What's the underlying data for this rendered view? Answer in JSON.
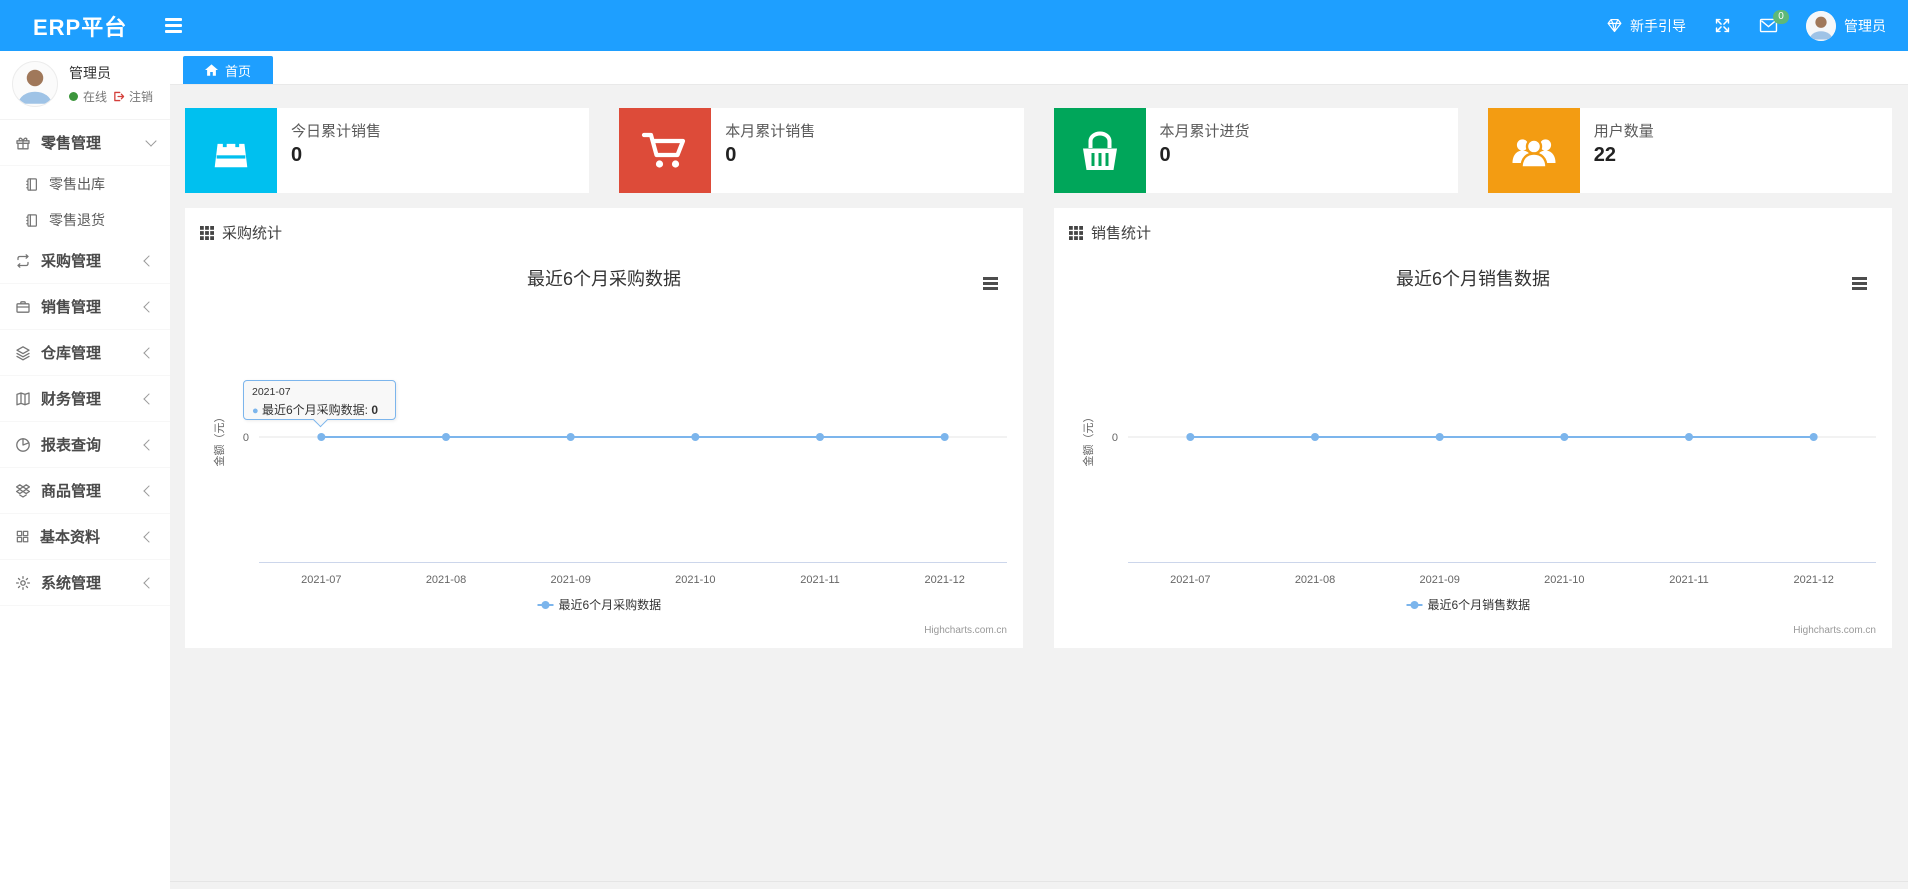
{
  "navbar": {
    "brand": "ERP平台",
    "guide_label": "新手引导",
    "mail_badge": "0",
    "user_name": "管理员",
    "badge_color": "#5FB878",
    "bar_color": "#1E9FFF"
  },
  "sidebar": {
    "user": {
      "name": "管理员",
      "status_label": "在线",
      "logout_label": "注销"
    },
    "items": [
      {
        "id": "retail",
        "label": "零售管理",
        "icon": "gift-icon",
        "expanded": true,
        "children": [
          {
            "id": "retail-outbound",
            "label": "零售出库",
            "icon": "journal-icon"
          },
          {
            "id": "retail-return",
            "label": "零售退货",
            "icon": "journal-icon"
          }
        ]
      },
      {
        "id": "purchase",
        "label": "采购管理",
        "icon": "loop-icon"
      },
      {
        "id": "sales",
        "label": "销售管理",
        "icon": "briefcase-icon"
      },
      {
        "id": "warehouse",
        "label": "仓库管理",
        "icon": "layers-icon"
      },
      {
        "id": "finance",
        "label": "财务管理",
        "icon": "book-icon"
      },
      {
        "id": "reports",
        "label": "报表查询",
        "icon": "pie-chart-icon"
      },
      {
        "id": "goods",
        "label": "商品管理",
        "icon": "box-icon"
      },
      {
        "id": "basic-data",
        "label": "基本资料",
        "icon": "grid-icon"
      },
      {
        "id": "system",
        "label": "系统管理",
        "icon": "gear-icon"
      }
    ]
  },
  "tabs": [
    {
      "id": "home",
      "label": "首页",
      "icon": "home-icon",
      "active": true
    }
  ],
  "stat_cards": [
    {
      "id": "today-sales",
      "label": "今日累计销售",
      "value": "0",
      "icon": "shopping-bag-icon",
      "color": "#00c0ef"
    },
    {
      "id": "month-sales",
      "label": "本月累计销售",
      "value": "0",
      "icon": "cart-icon",
      "color": "#dd4b39"
    },
    {
      "id": "month-purchase",
      "label": "本月累计进货",
      "value": "0",
      "icon": "basket-icon",
      "color": "#00a65a"
    },
    {
      "id": "user-count",
      "label": "用户数量",
      "value": "22",
      "icon": "users-icon",
      "color": "#f39c12"
    }
  ],
  "panels": [
    {
      "id": "purchase-stats",
      "title": "采购统计"
    },
    {
      "id": "sales-stats",
      "title": "销售统计"
    }
  ],
  "chart_data": [
    {
      "type": "line",
      "title": "最近6个月采购数据",
      "categories": [
        "2021-07",
        "2021-08",
        "2021-09",
        "2021-10",
        "2021-11",
        "2021-12"
      ],
      "series": [
        {
          "name": "最近6个月采购数据",
          "values": [
            0,
            0,
            0,
            0,
            0,
            0
          ]
        }
      ],
      "xlabel": "",
      "ylabel": "金额（元）",
      "yticks": [
        "0"
      ],
      "line_color": "#7cb5ec",
      "grid": true,
      "legend_position": "bottom",
      "credits": "Highcharts.com.cn",
      "tooltip": {
        "visible": true,
        "header": "2021-07",
        "series_label": "最近6个月采购数据",
        "value": "0"
      }
    },
    {
      "type": "line",
      "title": "最近6个月销售数据",
      "categories": [
        "2021-07",
        "2021-08",
        "2021-09",
        "2021-10",
        "2021-11",
        "2021-12"
      ],
      "series": [
        {
          "name": "最近6个月销售数据",
          "values": [
            0,
            0,
            0,
            0,
            0,
            0
          ]
        }
      ],
      "xlabel": "",
      "ylabel": "金额（元）",
      "yticks": [
        "0"
      ],
      "line_color": "#7cb5ec",
      "grid": true,
      "legend_position": "bottom",
      "credits": "Highcharts.com.cn",
      "tooltip": {
        "visible": false
      }
    }
  ]
}
